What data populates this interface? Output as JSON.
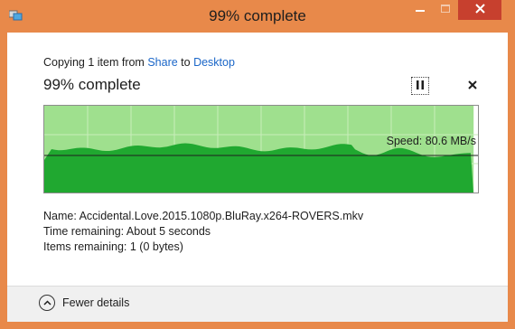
{
  "window": {
    "title": "99% complete",
    "accent_color": "#e8894a",
    "close_color": "#c7402e"
  },
  "copy": {
    "prefix": "Copying 1 item from ",
    "source": "Share",
    "middle": " to ",
    "destination": "Desktop",
    "heading": "99% complete"
  },
  "graph": {
    "speed_label": "Speed: 80.6 MB/s",
    "progress_percent": 99,
    "fill_color": "#20a830",
    "progress_color": "#9fe08e"
  },
  "details": {
    "name": "Name:  Accidental.Love.2015.1080p.BluRay.x264-ROVERS.mkv",
    "time_remaining": "Time remaining:  About 5 seconds",
    "items_remaining": "Items remaining:  1 (0 bytes)"
  },
  "footer": {
    "fewer_details": "Fewer details"
  },
  "icons": [
    "copy-app-icon",
    "minimize-icon",
    "maximize-icon",
    "close-icon",
    "pause-icon",
    "cancel-icon",
    "chevron-up-icon"
  ]
}
